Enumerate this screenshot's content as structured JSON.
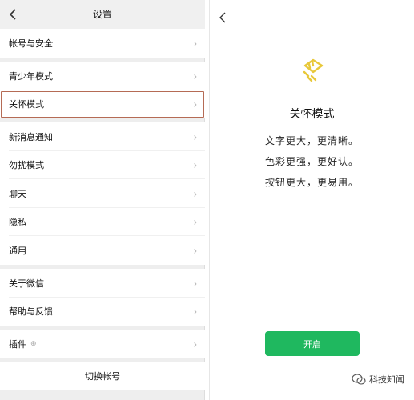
{
  "settings": {
    "title": "设置",
    "groups": [
      {
        "items": [
          {
            "label": "帐号与安全"
          }
        ]
      },
      {
        "items": [
          {
            "label": "青少年模式"
          },
          {
            "label": "关怀模式",
            "highlighted": true
          }
        ]
      },
      {
        "items": [
          {
            "label": "新消息通知"
          },
          {
            "label": "勿扰模式"
          },
          {
            "label": "聊天"
          },
          {
            "label": "隐私"
          },
          {
            "label": "通用"
          }
        ]
      },
      {
        "items": [
          {
            "label": "关于微信"
          },
          {
            "label": "帮助与反馈"
          }
        ]
      },
      {
        "items": [
          {
            "label": "插件",
            "badge": "⊕"
          }
        ]
      }
    ],
    "switch_account": "切换帐号"
  },
  "care_mode": {
    "title": "关怀模式",
    "lines": [
      "文字更大，更清晰。",
      "色彩更强，更好认。",
      "按钮更大，更易用。"
    ],
    "button": "开启",
    "icon": "care-mode-icon",
    "accent_color": "#1fb85f",
    "icon_color": "#e8c83a"
  },
  "watermark": {
    "text": "科技知闻"
  }
}
